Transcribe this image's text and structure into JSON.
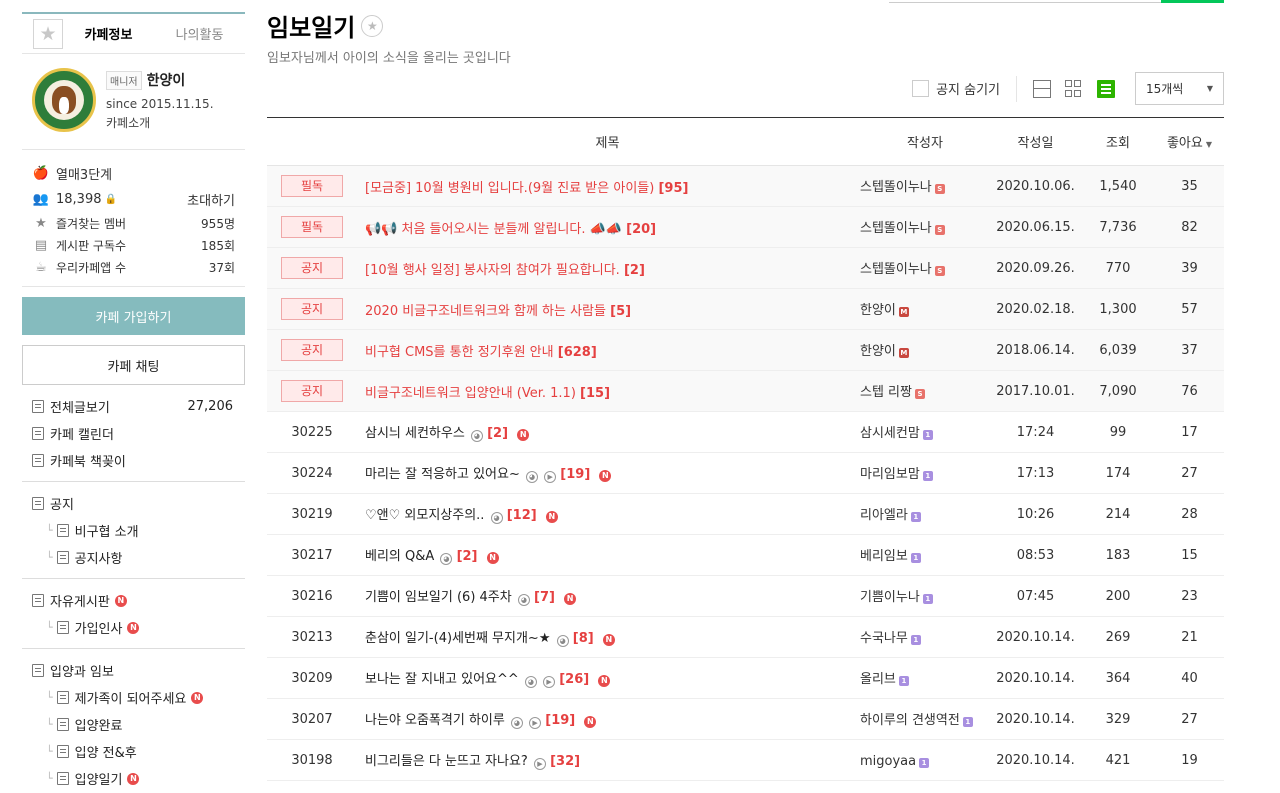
{
  "sidebar": {
    "tabs": [
      "카페정보",
      "나의활동"
    ],
    "manager_tag": "매니저",
    "manager_name": "한양이",
    "since": "since 2015.11.15.",
    "cafe_intro": "카페소개",
    "level": "열매3단계",
    "members": "18,398",
    "invite": "초대하기",
    "stats": [
      {
        "label": "즐겨찾는 멤버",
        "value": "955명"
      },
      {
        "label": "게시판 구독수",
        "value": "185회"
      },
      {
        "label": "우리카페앱 수",
        "value": "37회"
      }
    ],
    "join_button": "카페 가입하기",
    "chat_button": "카페 채팅",
    "menu_top": [
      {
        "label": "전체글보기",
        "count": "27,206"
      },
      {
        "label": "카페 캘린더"
      },
      {
        "label": "카페북 책꽂이"
      }
    ],
    "menu_notice": {
      "label": "공지",
      "children": [
        "비구협 소개",
        "공지사항"
      ]
    },
    "menu_free": {
      "label": "자유게시판",
      "children": [
        "가입인사"
      ]
    },
    "menu_adopt": {
      "label": "입양과 임보",
      "children": [
        "제가족이 되어주세요",
        "입양완료",
        "입양 전&후",
        "입양일기"
      ]
    }
  },
  "board": {
    "title": "임보일기",
    "description": "임보자님께서 아이의 소식을 올리는 곳입니다",
    "hide_notice": "공지 숨기기",
    "per_page": "15개씩",
    "columns": {
      "title": "제목",
      "author": "작성자",
      "date": "작성일",
      "views": "조회",
      "likes": "좋아요"
    },
    "rows": [
      {
        "num": "필독",
        "notice": true,
        "title": "[모금중] 10월 병원비 입니다.(9월 진료 받은 아이들)",
        "comments": "[95]",
        "author": "스텝똘이누나",
        "level": "S",
        "date": "2020.10.06.",
        "views": "1,540",
        "likes": "35"
      },
      {
        "num": "필독",
        "notice": true,
        "title": "📢📢 처음 들어오시는 분들께 알립니다. 📣📣",
        "comments": "[20]",
        "author": "스텝똘이누나",
        "level": "S",
        "date": "2020.06.15.",
        "views": "7,736",
        "likes": "82"
      },
      {
        "num": "공지",
        "notice": true,
        "title": "[10월 행사 일정] 봉사자의 참여가 필요합니다.",
        "comments": "[2]",
        "author": "스텝똘이누나",
        "level": "S",
        "date": "2020.09.26.",
        "views": "770",
        "likes": "39"
      },
      {
        "num": "공지",
        "notice": true,
        "title": "2020 비글구조네트워크와 함께 하는 사람들",
        "comments": "[5]",
        "author": "한양이",
        "level": "M",
        "date": "2020.02.18.",
        "views": "1,300",
        "likes": "57"
      },
      {
        "num": "공지",
        "notice": true,
        "title": "비구협 CMS를 통한 정기후원 안내",
        "comments": "[628]",
        "author": "한양이",
        "level": "M",
        "date": "2018.06.14.",
        "views": "6,039",
        "likes": "37"
      },
      {
        "num": "공지",
        "notice": true,
        "title": "비글구조네트워크 입양안내 (Ver. 1.1)",
        "comments": "[15]",
        "author": "스텝 리짱",
        "level": "S",
        "date": "2017.10.01.",
        "views": "7,090",
        "likes": "76"
      },
      {
        "num": "30225",
        "notice": false,
        "title": "삼시늬 세컨하우스",
        "comments": "[2]",
        "photo": true,
        "video": false,
        "new": true,
        "author": "삼시세컨맘",
        "level": "1",
        "date": "17:24",
        "views": "99",
        "likes": "17"
      },
      {
        "num": "30224",
        "notice": false,
        "title": "마리는 잘 적응하고 있어요~",
        "comments": "[19]",
        "photo": true,
        "video": true,
        "new": true,
        "author": "마리임보맘",
        "level": "1",
        "date": "17:13",
        "views": "174",
        "likes": "27"
      },
      {
        "num": "30219",
        "notice": false,
        "title": "♡앤♡ 외모지상주의..",
        "comments": "[12]",
        "photo": true,
        "video": false,
        "new": true,
        "author": "리아엘라",
        "level": "1",
        "date": "10:26",
        "views": "214",
        "likes": "28"
      },
      {
        "num": "30217",
        "notice": false,
        "title": "베리의 Q&A",
        "comments": "[2]",
        "photo": true,
        "video": false,
        "new": true,
        "author": "베리임보",
        "level": "1",
        "date": "08:53",
        "views": "183",
        "likes": "15"
      },
      {
        "num": "30216",
        "notice": false,
        "title": "기쁨이 임보일기 (6) 4주차",
        "comments": "[7]",
        "photo": true,
        "video": false,
        "new": true,
        "author": "기쁨이누나",
        "level": "1",
        "date": "07:45",
        "views": "200",
        "likes": "23"
      },
      {
        "num": "30213",
        "notice": false,
        "title": "춘삼이 일기-(4)세번째 무지개~★",
        "comments": "[8]",
        "photo": true,
        "video": false,
        "new": true,
        "author": "수국나무",
        "level": "1",
        "date": "2020.10.14.",
        "views": "269",
        "likes": "21"
      },
      {
        "num": "30209",
        "notice": false,
        "title": "보나는 잘 지내고 있어요^^",
        "comments": "[26]",
        "photo": true,
        "video": true,
        "new": true,
        "author": "올리브",
        "level": "1",
        "date": "2020.10.14.",
        "views": "364",
        "likes": "40"
      },
      {
        "num": "30207",
        "notice": false,
        "title": "나는야 오줌폭격기 하이루",
        "comments": "[19]",
        "photo": true,
        "video": true,
        "new": true,
        "author": "하이루의 견생역전",
        "level": "1",
        "date": "2020.10.14.",
        "views": "329",
        "likes": "27"
      },
      {
        "num": "30198",
        "notice": false,
        "title": "비그리들은 다 눈뜨고 자나요?",
        "comments": "[32]",
        "photo": false,
        "video": true,
        "new": false,
        "author": "migoyaa",
        "level": "1",
        "date": "2020.10.14.",
        "views": "421",
        "likes": "19"
      }
    ]
  }
}
